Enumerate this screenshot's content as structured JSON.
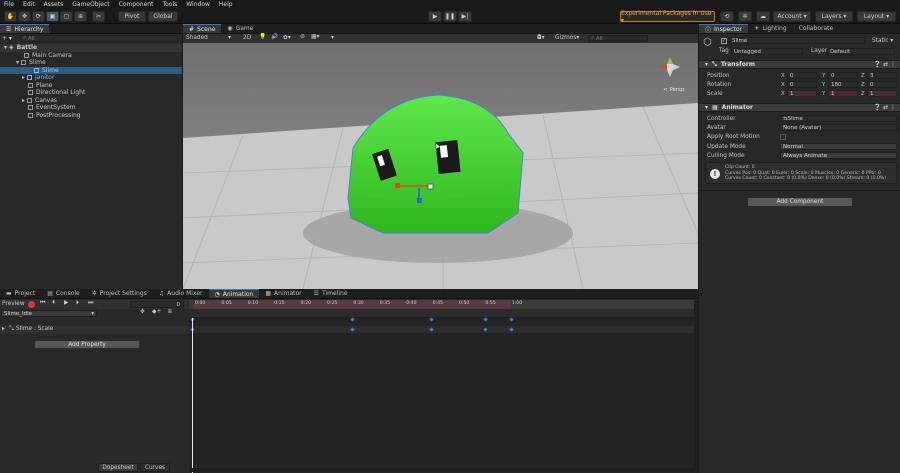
{
  "menu": [
    "File",
    "Edit",
    "Assets",
    "GameObject",
    "Component",
    "Tools",
    "Window",
    "Help"
  ],
  "toolbar": {
    "pivot": "Pivot",
    "global": "Global",
    "experimental": "Experimental Packages In Use ▾",
    "account": "Account",
    "layers": "Layers",
    "layout": "Layout"
  },
  "hierarchy": {
    "tab": "Hierarchy",
    "search_placeholder": "All",
    "items": [
      {
        "label": "Battle"
      },
      {
        "label": "Main Camera"
      },
      {
        "label": "Slime"
      },
      {
        "label": "Slime"
      },
      {
        "label": "Janitor"
      },
      {
        "label": "Plane"
      },
      {
        "label": "Directional Light"
      },
      {
        "label": "Canvas"
      },
      {
        "label": "EventSystem"
      },
      {
        "label": "PostProcessing"
      }
    ]
  },
  "scene": {
    "tabs": [
      "Scene",
      "Game"
    ],
    "shading": "Shaded",
    "mode_2d": "2D",
    "gizmos": "Gizmos",
    "search_placeholder": "All",
    "persp": "< Persp"
  },
  "inspector": {
    "tabs": [
      "Inspector",
      "Lighting",
      "Collaborate"
    ],
    "object_name": "Slime",
    "static": "Static",
    "tag_label": "Tag",
    "tag_value": "Untagged",
    "layer_label": "Layer",
    "layer_value": "Default",
    "transform": {
      "title": "Transform",
      "position_label": "Position",
      "rotation_label": "Rotation",
      "scale_label": "Scale",
      "position": {
        "x": "0",
        "y": "0",
        "z": "3"
      },
      "rotation": {
        "x": "0",
        "y": "180",
        "z": "0"
      },
      "scale": {
        "x": "1",
        "y": "1",
        "z": "1"
      }
    },
    "animator": {
      "title": "Animator",
      "controller_label": "Controller",
      "controller_value": "Slime",
      "avatar_label": "Avatar",
      "avatar_value": "None (Avatar)",
      "root_motion_label": "Apply Root Motion",
      "update_label": "Update Mode",
      "update_value": "Normal",
      "culling_label": "Culling Mode",
      "culling_value": "Always Animate",
      "info_line1": "Clip Count: 0",
      "info_line2": "Curves Pos: 0 Quat: 0 Euler: 0 Scale: 0 Muscles: 0 Generic: 0 PPtr: 0",
      "info_line3": "Curves Count: 0 Constant: 0 (0.0%) Dense: 0 (0.0%) Stream: 0 (0.0%)"
    },
    "add_component": "Add Component"
  },
  "bottom": {
    "tabs": [
      "Project",
      "Console",
      "Project Settings",
      "Audio Mixer",
      "Animation",
      "Animator",
      "Timeline"
    ],
    "preview": "Preview",
    "frame": "0",
    "clip": "Slime_Idle",
    "property": "Slime : Scale",
    "add_property": "Add Property",
    "dopesheet": "Dopesheet",
    "curves": "Curves",
    "ruler": [
      "0:00",
      "0:05",
      "0:10",
      "0:15",
      "0:20",
      "0:25",
      "0:30",
      "0:35",
      "0:40",
      "0:45",
      "0:50",
      "0:55",
      "1:00"
    ]
  }
}
